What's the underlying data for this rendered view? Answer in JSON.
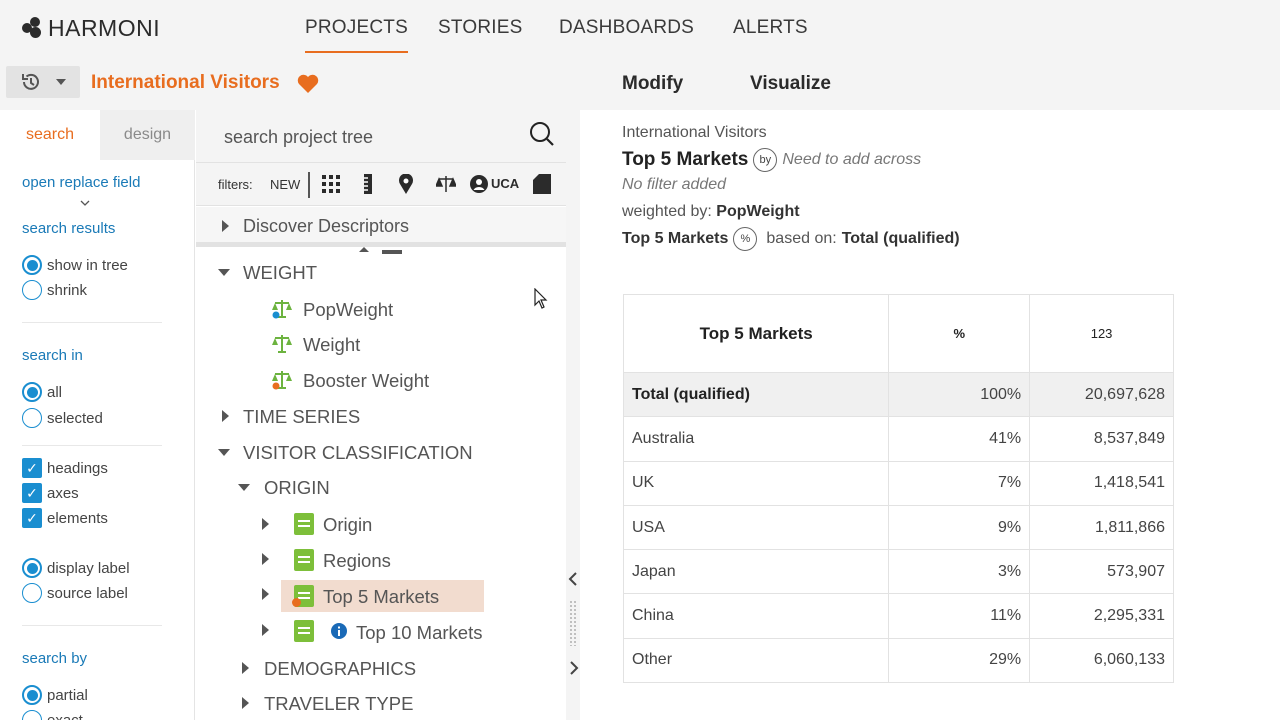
{
  "app": {
    "logo_text": "HARMONI"
  },
  "nav": {
    "tabs": [
      "PROJECTS",
      "STORIES",
      "DASHBOARDS",
      "ALERTS"
    ]
  },
  "project": {
    "title": "International Visitors"
  },
  "right_tabs": [
    "Modify",
    "Visualize"
  ],
  "left_panel": {
    "tabs": {
      "search": "search",
      "design": "design"
    },
    "open_replace_field": "open replace field",
    "search_results": {
      "heading": "search results",
      "options": [
        {
          "label": "show in tree",
          "selected": true
        },
        {
          "label": "shrink",
          "selected": false
        }
      ]
    },
    "search_in": {
      "heading": "search in",
      "options": [
        {
          "label": "all",
          "selected": true
        },
        {
          "label": "selected",
          "selected": false
        }
      ]
    },
    "checks": [
      {
        "label": "headings",
        "checked": true
      },
      {
        "label": "axes",
        "checked": true
      },
      {
        "label": "elements",
        "checked": true
      }
    ],
    "label_mode": [
      {
        "label": "display label",
        "selected": true
      },
      {
        "label": "source label",
        "selected": false
      }
    ],
    "search_by": {
      "heading": "search by",
      "options": [
        {
          "label": "partial",
          "selected": true
        },
        {
          "label": "exact",
          "selected": false
        }
      ]
    }
  },
  "tree": {
    "search_placeholder": "search project tree",
    "filters_label": "filters:",
    "filter_new": "NEW",
    "filter_uca": "UCA",
    "discover": "Discover Descriptors",
    "items": {
      "weight": "WEIGHT",
      "popweight": "PopWeight",
      "weight_item": "Weight",
      "booster": "Booster Weight",
      "time_series": "TIME SERIES",
      "visitor_class": "VISITOR CLASSIFICATION",
      "origin_folder": "ORIGIN",
      "origin": "Origin",
      "regions": "Regions",
      "top5": "Top 5 Markets",
      "top10": "Top 10 Markets",
      "demographics": "DEMOGRAPHICS",
      "traveler_type": "TRAVELER TYPE"
    }
  },
  "summary": {
    "project": "International Visitors",
    "table_name": "Top 5 Markets",
    "by_badge": "by",
    "across_note": "Need to add across",
    "filter_note": "No filter added",
    "weighted_label": "weighted by:",
    "weighted_value": "PopWeight",
    "pct_badge": "%",
    "based_on_label": "based on:",
    "based_on_value": "Total (qualified)"
  },
  "table": {
    "headers": [
      "Top 5 Markets",
      "%",
      "123"
    ],
    "rows": [
      {
        "label": "Total (qualified)",
        "pct": "100%",
        "count": "20,697,628"
      },
      {
        "label": "Australia",
        "pct": "41%",
        "count": "8,537,849"
      },
      {
        "label": "UK",
        "pct": "7%",
        "count": "1,418,541"
      },
      {
        "label": "USA",
        "pct": "9%",
        "count": "1,811,866"
      },
      {
        "label": "Japan",
        "pct": "3%",
        "count": "573,907"
      },
      {
        "label": "China",
        "pct": "11%",
        "count": "2,295,331"
      },
      {
        "label": "Other",
        "pct": "29%",
        "count": "6,060,133"
      }
    ]
  },
  "colors": {
    "accent": "#e86d1f",
    "link": "#1a7ab7",
    "control": "#1a8ed0",
    "highlight": "#f2dccf"
  },
  "icons": [
    "logo-mark-icon",
    "history-icon",
    "chevron-down-icon",
    "heart-icon",
    "search-icon",
    "grid-icon",
    "ruler-icon",
    "pin-icon",
    "scale-icon",
    "user-icon",
    "tag-icon",
    "weight-scale-icon",
    "doc-icon",
    "info-icon",
    "cursor-icon",
    "chevron-left-icon",
    "chevron-right-icon"
  ]
}
